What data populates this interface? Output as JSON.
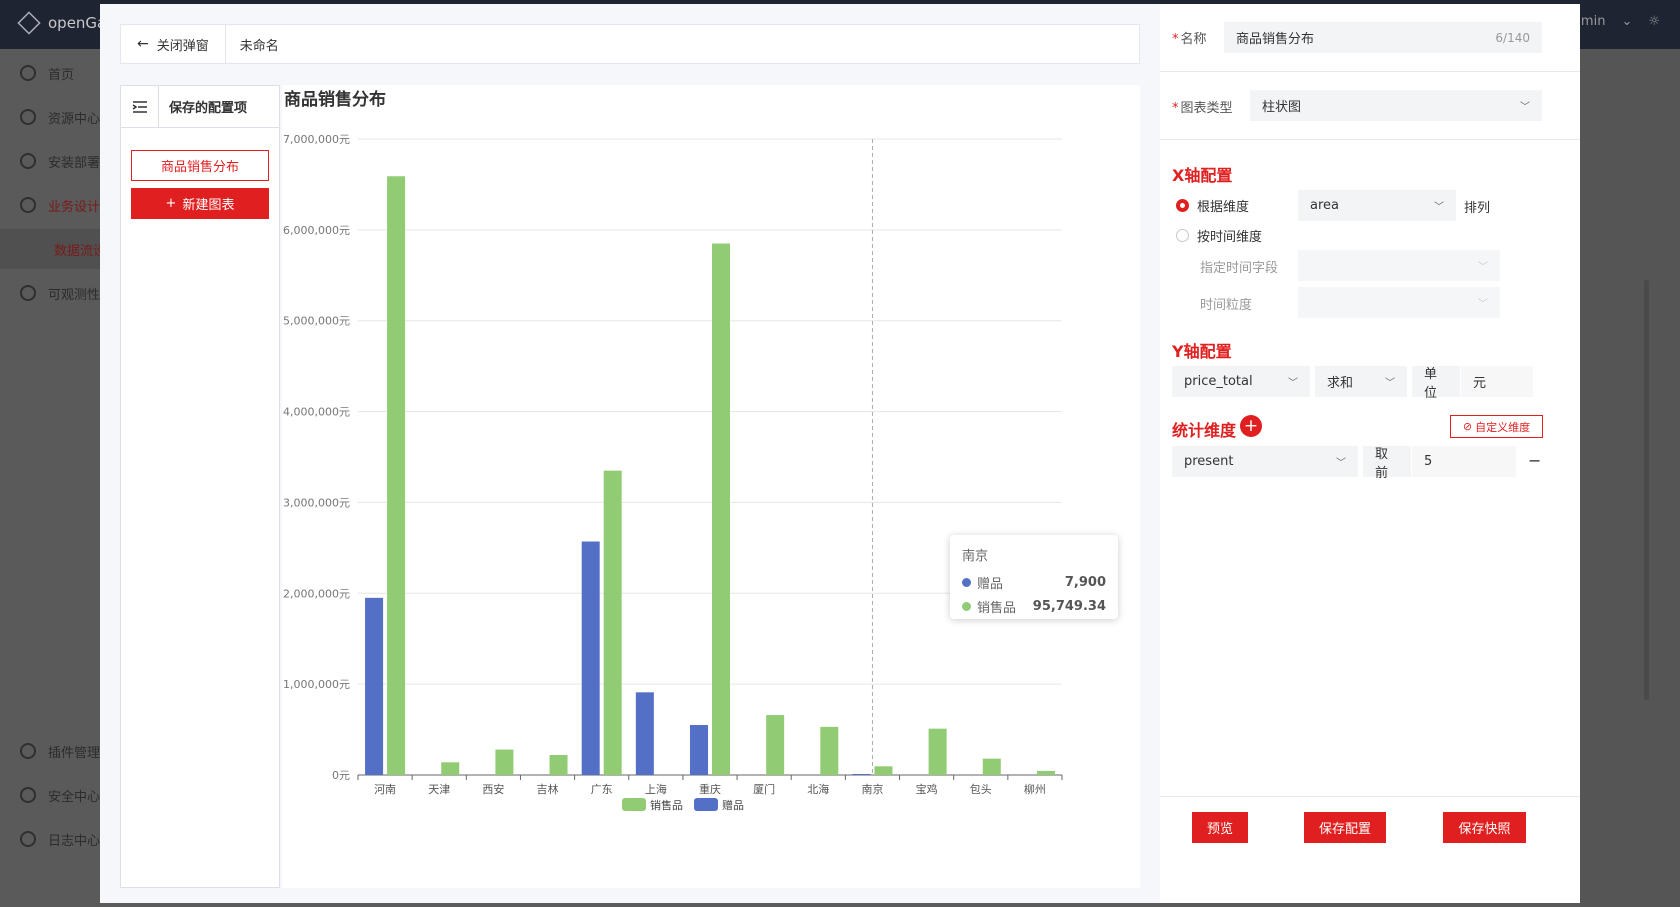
{
  "app": {
    "logo_text": "openGa",
    "user": "admin"
  },
  "sidebar": {
    "items": [
      {
        "label": "首页",
        "icon": "home-icon"
      },
      {
        "label": "资源中心",
        "icon": "resource-icon"
      },
      {
        "label": "安装部署",
        "icon": "gear-icon"
      },
      {
        "label": "业务设计",
        "icon": "gear-icon"
      },
      {
        "label": "数据流设计",
        "icon": ""
      },
      {
        "label": "可观测性",
        "icon": "gear-icon"
      },
      {
        "label": "插件管理",
        "icon": "plugin-icon"
      },
      {
        "label": "安全中心",
        "icon": "shield-icon"
      },
      {
        "label": "日志中心",
        "icon": "log-icon"
      }
    ]
  },
  "modal": {
    "back_label": "关闭弹窗",
    "chart_name_placeholder": "未命名",
    "saved_title": "保存的配置项",
    "saved_items": [
      "商品销售分布"
    ],
    "new_chart_label": "新建图表"
  },
  "chart_data": {
    "type": "bar",
    "title": "商品销售分布",
    "categories": [
      "河南",
      "天津",
      "西安",
      "吉林",
      "广东",
      "上海",
      "重庆",
      "厦门",
      "北海",
      "南京",
      "宝鸡",
      "包头",
      "柳州"
    ],
    "series": [
      {
        "name": "赠品",
        "color": "#5470c6",
        "values": [
          1950000,
          0,
          0,
          0,
          2570000,
          910000,
          550000,
          0,
          0,
          7900,
          0,
          0,
          0
        ]
      },
      {
        "name": "销售品",
        "color": "#91cc75",
        "values": [
          6590000,
          140000,
          280000,
          220000,
          3350000,
          0,
          5850000,
          660000,
          530000,
          95749.34,
          510000,
          180000,
          45000
        ]
      }
    ],
    "legend_order": [
      "销售品",
      "赠品"
    ],
    "y_ticks": [
      "0元",
      "1,000,000元",
      "2,000,000元",
      "3,000,000元",
      "4,000,000元",
      "5,000,000元",
      "6,000,000元",
      "7,000,000元"
    ],
    "ylim": [
      0,
      7000000
    ],
    "grid": true,
    "legend_position": "bottom-center",
    "tooltip": {
      "category": "南京",
      "rows": [
        {
          "name": "赠品",
          "value": "7,900",
          "color": "#5470c6"
        },
        {
          "name": "销售品",
          "value": "95,749.34",
          "color": "#91cc75"
        }
      ]
    }
  },
  "config": {
    "name_label": "名称",
    "name_value": "商品销售分布",
    "name_counter": "6/140",
    "chart_type_label": "图表类型",
    "chart_type_value": "柱状图",
    "x_section": "X轴配置",
    "x_by_dimension": "根据维度",
    "x_dimension_value": "area",
    "x_sort_label": "排列",
    "x_by_time": "按时间维度",
    "time_field_label": "指定时间字段",
    "time_granularity_label": "时间粒度",
    "y_section": "Y轴配置",
    "y_field": "price_total",
    "y_agg": "求和",
    "unit_label": "单位",
    "unit_value": "元",
    "stat_section": "统计维度",
    "custom_dim_label": "自定义维度",
    "stat_dim_value": "present",
    "top_label": "取前",
    "top_value": "5"
  },
  "footer": {
    "preview": "预览",
    "save_config": "保存配置",
    "save_snapshot": "保存快照"
  },
  "colors": {
    "accent": "#e02020",
    "series_gift": "#5470c6",
    "series_sale": "#91cc75"
  }
}
